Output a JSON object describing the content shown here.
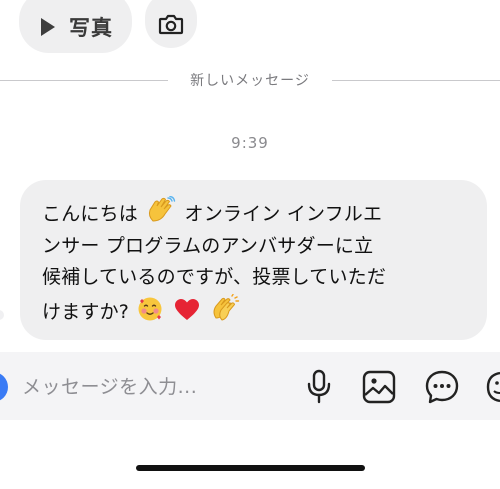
{
  "top_bar": {
    "photo_label": "写真"
  },
  "divider": {
    "label": "新しいメッセージ"
  },
  "message": {
    "time": "9:39",
    "line1": "こんにちは",
    "line1b": "オンライン インフルエ",
    "line2": "ンサー プログラムのアンバサダーに立",
    "line3": "候補しているのですが、投票していただ",
    "line4": "けますか?"
  },
  "composer": {
    "placeholder": "メッセージを入力..."
  },
  "icons": [
    "play-icon",
    "camera-icon",
    "microphone-icon",
    "image-icon",
    "chat-bubble-icon",
    "sticker-icon"
  ],
  "colors": {
    "bubble": "#efeff0",
    "accent": "#3a7bf5",
    "composer_bg": "#f4f4f6"
  }
}
